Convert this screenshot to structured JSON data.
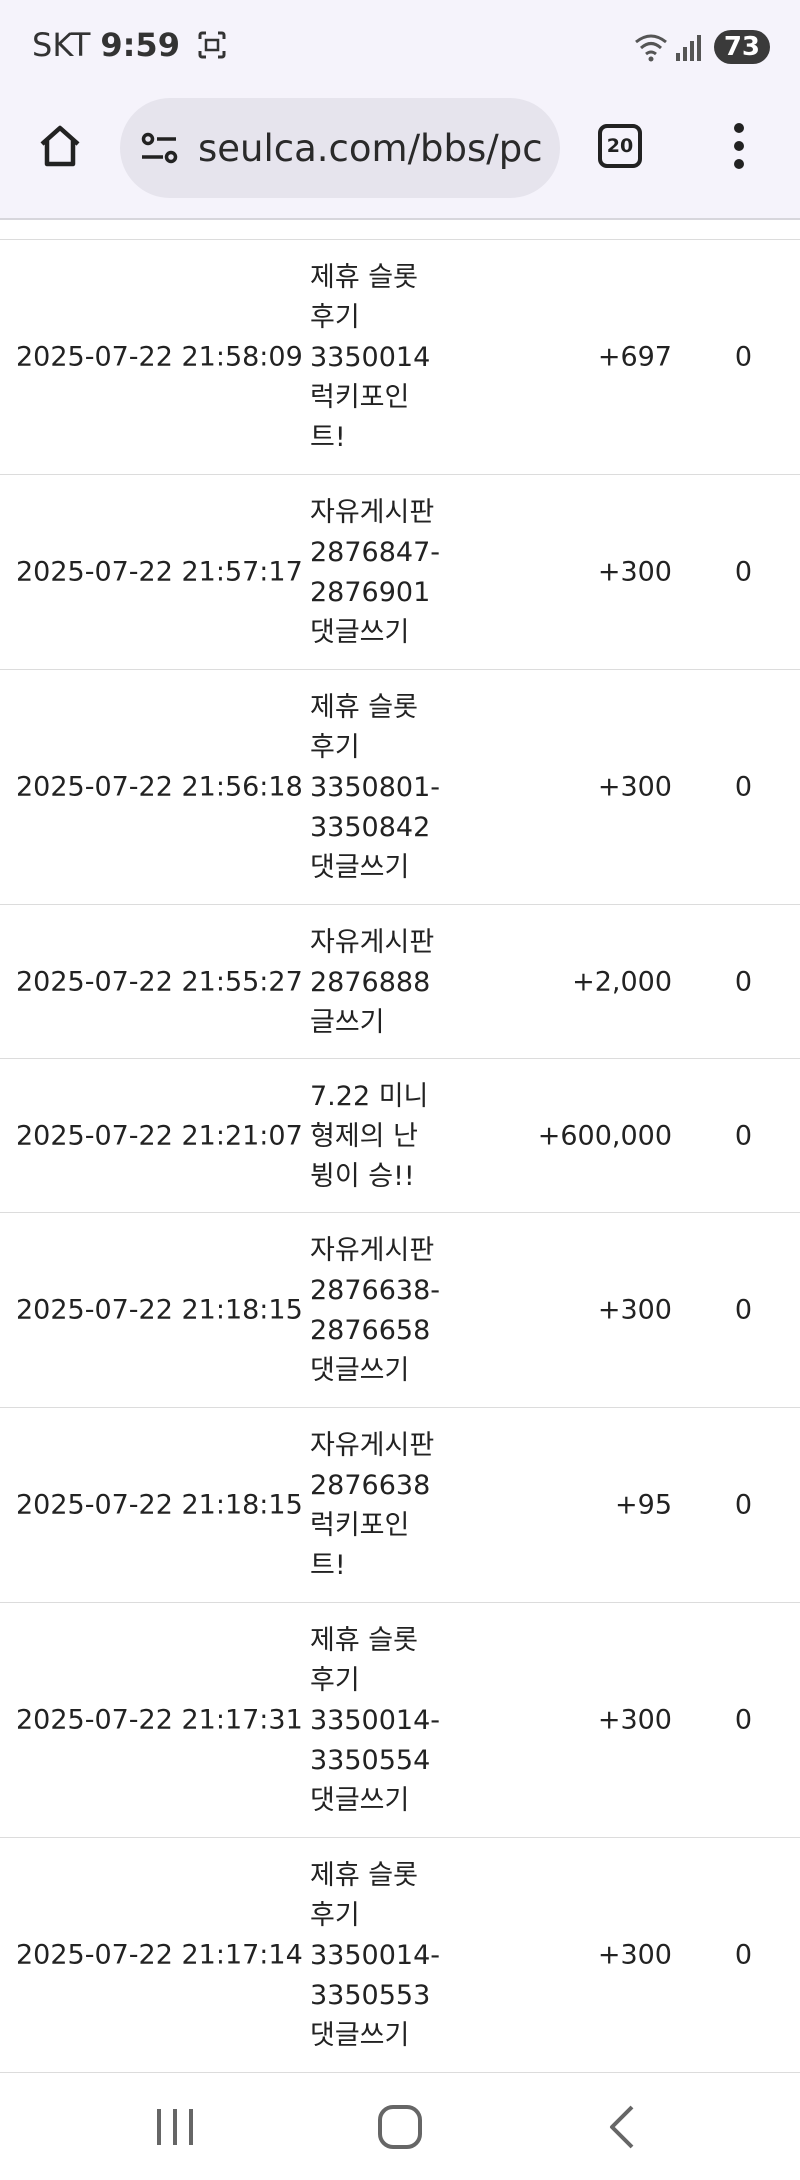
{
  "status": {
    "carrier": "SKT",
    "time": "9:59",
    "battery": "73"
  },
  "browser": {
    "url": "seulca.com/bbs/pc",
    "tab_count": "20"
  },
  "rows": [
    {
      "date": "2025-07-22 21:58:09",
      "desc": [
        "제휴 슬롯",
        "후기",
        "3350014",
        "럭키포인",
        "트!"
      ],
      "point": "+697",
      "used": "0"
    },
    {
      "date": "2025-07-22 21:57:17",
      "desc": [
        "자유게시판",
        "2876847-",
        "2876901",
        "댓글쓰기"
      ],
      "point": "+300",
      "used": "0"
    },
    {
      "date": "2025-07-22 21:56:18",
      "desc": [
        "제휴 슬롯",
        "후기",
        "3350801-",
        "3350842",
        "댓글쓰기"
      ],
      "point": "+300",
      "used": "0"
    },
    {
      "date": "2025-07-22 21:55:27",
      "desc": [
        "자유게시판",
        "2876888",
        "글쓰기"
      ],
      "point": "+2,000",
      "used": "0"
    },
    {
      "date": "2025-07-22 21:21:07",
      "desc": [
        "7.22 미니",
        "형제의 난",
        "뷩이 승!!"
      ],
      "point": "+600,000",
      "used": "0"
    },
    {
      "date": "2025-07-22 21:18:15",
      "desc": [
        "자유게시판",
        "2876638-",
        "2876658",
        "댓글쓰기"
      ],
      "point": "+300",
      "used": "0"
    },
    {
      "date": "2025-07-22 21:18:15",
      "desc": [
        "자유게시판",
        "2876638",
        "럭키포인",
        "트!"
      ],
      "point": "+95",
      "used": "0"
    },
    {
      "date": "2025-07-22 21:17:31",
      "desc": [
        "제휴 슬롯",
        "후기",
        "3350014-",
        "3350554",
        "댓글쓰기"
      ],
      "point": "+300",
      "used": "0"
    },
    {
      "date": "2025-07-22 21:17:14",
      "desc": [
        "제휴 슬롯",
        "후기",
        "3350014-",
        "3350553",
        "댓글쓰기"
      ],
      "point": "+300",
      "used": "0"
    }
  ]
}
